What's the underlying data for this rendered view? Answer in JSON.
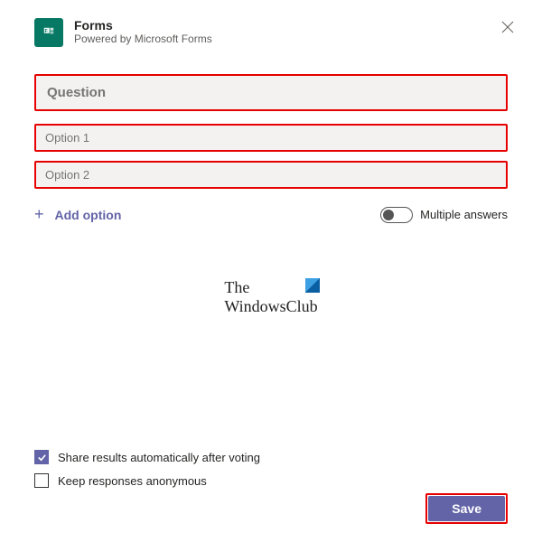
{
  "header": {
    "title": "Forms",
    "subtitle": "Powered by Microsoft Forms"
  },
  "form": {
    "question_placeholder": "Question",
    "options": [
      "Option 1",
      "Option 2"
    ],
    "add_option_label": "Add option",
    "multiple_answers_label": "Multiple answers"
  },
  "watermark": {
    "line1": "The",
    "line2": "WindowsClub"
  },
  "checks": {
    "share_label": "Share results automatically after voting",
    "anon_label": "Keep responses anonymous",
    "share_checked": true,
    "anon_checked": false
  },
  "footer": {
    "save_label": "Save"
  }
}
